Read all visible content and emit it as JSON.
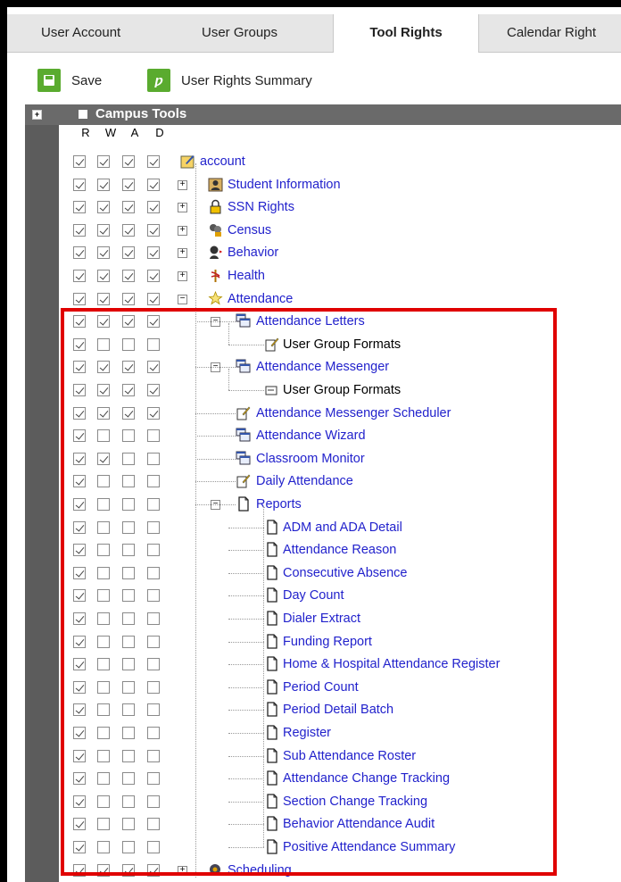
{
  "tabs": [
    {
      "label": "User Account"
    },
    {
      "label": "User Groups"
    },
    {
      "label": "Tool Rights",
      "active": true
    },
    {
      "label": "Calendar Right"
    }
  ],
  "toolbar": {
    "save_label": "Save",
    "summary_label": "User Rights Summary"
  },
  "tree": {
    "root_title": "Campus Tools",
    "columns": [
      "R",
      "W",
      "A",
      "D"
    ]
  },
  "rows": [
    {
      "label": "account",
      "level": 0,
      "icon": "account-icon",
      "checks": [
        1,
        1,
        1,
        1
      ],
      "link": true
    },
    {
      "label": "Student Information",
      "level": 1,
      "icon": "student-icon",
      "checks": [
        1,
        1,
        1,
        1
      ],
      "link": true,
      "expander": "+"
    },
    {
      "label": "SSN Rights",
      "level": 1,
      "icon": "lock-icon",
      "checks": [
        1,
        1,
        1,
        1
      ],
      "link": true,
      "expander": "+"
    },
    {
      "label": "Census",
      "level": 1,
      "icon": "census-icon",
      "checks": [
        1,
        1,
        1,
        1
      ],
      "link": true,
      "expander": "+"
    },
    {
      "label": "Behavior",
      "level": 1,
      "icon": "behavior-icon",
      "checks": [
        1,
        1,
        1,
        1
      ],
      "link": true,
      "expander": "+"
    },
    {
      "label": "Health",
      "level": 1,
      "icon": "health-icon",
      "checks": [
        1,
        1,
        1,
        1
      ],
      "link": true,
      "expander": "+"
    },
    {
      "label": "Attendance",
      "level": 1,
      "icon": "attendance-icon",
      "checks": [
        1,
        1,
        1,
        1
      ],
      "link": true,
      "expander": "-"
    },
    {
      "label": "Attendance Letters",
      "level": 2,
      "icon": "windows-icon",
      "checks": [
        1,
        1,
        1,
        1
      ],
      "link": true,
      "expander": "-"
    },
    {
      "label": "User Group Formats",
      "level": 3,
      "icon": "edit-doc-icon",
      "checks": [
        1,
        0,
        0,
        0
      ],
      "link": false
    },
    {
      "label": "Attendance Messenger",
      "level": 2,
      "icon": "windows-icon",
      "checks": [
        1,
        1,
        1,
        1
      ],
      "link": true,
      "expander": "-"
    },
    {
      "label": "User Group Formats",
      "level": 3,
      "icon": "arrow-doc-icon",
      "checks": [
        1,
        1,
        1,
        1
      ],
      "link": false
    },
    {
      "label": "Attendance Messenger Scheduler",
      "level": 2,
      "icon": "edit-doc-icon",
      "checks": [
        1,
        1,
        1,
        1
      ],
      "link": true
    },
    {
      "label": "Attendance Wizard",
      "level": 2,
      "icon": "windows-icon",
      "checks": [
        1,
        0,
        0,
        0
      ],
      "link": true
    },
    {
      "label": "Classroom Monitor",
      "level": 2,
      "icon": "windows-icon",
      "checks": [
        1,
        1,
        0,
        0
      ],
      "link": true
    },
    {
      "label": "Daily Attendance",
      "level": 2,
      "icon": "edit-doc-icon",
      "checks": [
        1,
        0,
        0,
        0
      ],
      "link": true
    },
    {
      "label": "Reports",
      "level": 2,
      "icon": "page-icon",
      "checks": [
        1,
        0,
        0,
        0
      ],
      "link": true,
      "expander": "-"
    },
    {
      "label": "ADM and ADA Detail",
      "level": 3,
      "icon": "page-icon",
      "checks": [
        1,
        0,
        0,
        0
      ],
      "link": true
    },
    {
      "label": "Attendance Reason",
      "level": 3,
      "icon": "page-icon",
      "checks": [
        1,
        0,
        0,
        0
      ],
      "link": true
    },
    {
      "label": "Consecutive Absence",
      "level": 3,
      "icon": "page-icon",
      "checks": [
        1,
        0,
        0,
        0
      ],
      "link": true
    },
    {
      "label": "Day Count",
      "level": 3,
      "icon": "page-icon",
      "checks": [
        1,
        0,
        0,
        0
      ],
      "link": true
    },
    {
      "label": "Dialer Extract",
      "level": 3,
      "icon": "page-icon",
      "checks": [
        1,
        0,
        0,
        0
      ],
      "link": true
    },
    {
      "label": "Funding Report",
      "level": 3,
      "icon": "page-icon",
      "checks": [
        1,
        0,
        0,
        0
      ],
      "link": true
    },
    {
      "label": "Home & Hospital Attendance Register",
      "level": 3,
      "icon": "page-icon",
      "checks": [
        1,
        0,
        0,
        0
      ],
      "link": true
    },
    {
      "label": "Period Count",
      "level": 3,
      "icon": "page-icon",
      "checks": [
        1,
        0,
        0,
        0
      ],
      "link": true
    },
    {
      "label": "Period Detail Batch",
      "level": 3,
      "icon": "page-icon",
      "checks": [
        1,
        0,
        0,
        0
      ],
      "link": true
    },
    {
      "label": "Register",
      "level": 3,
      "icon": "page-icon",
      "checks": [
        1,
        0,
        0,
        0
      ],
      "link": true
    },
    {
      "label": "Sub Attendance Roster",
      "level": 3,
      "icon": "page-icon",
      "checks": [
        1,
        0,
        0,
        0
      ],
      "link": true
    },
    {
      "label": "Attendance Change Tracking",
      "level": 3,
      "icon": "page-icon",
      "checks": [
        1,
        0,
        0,
        0
      ],
      "link": true
    },
    {
      "label": "Section Change Tracking",
      "level": 3,
      "icon": "page-icon",
      "checks": [
        1,
        0,
        0,
        0
      ],
      "link": true
    },
    {
      "label": "Behavior Attendance Audit",
      "level": 3,
      "icon": "page-icon",
      "checks": [
        1,
        0,
        0,
        0
      ],
      "link": true
    },
    {
      "label": "Positive Attendance Summary",
      "level": 3,
      "icon": "page-icon",
      "checks": [
        1,
        0,
        0,
        0
      ],
      "link": true
    },
    {
      "label": "Scheduling",
      "level": 1,
      "icon": "scheduling-icon",
      "checks": [
        1,
        1,
        1,
        1
      ],
      "link": true,
      "expander": "+"
    }
  ],
  "colors": {
    "link": "#2222cc",
    "highlight_box": "#e00000",
    "toolbar_icon": "#5aab2f",
    "header_bar": "#6a6a6a"
  }
}
